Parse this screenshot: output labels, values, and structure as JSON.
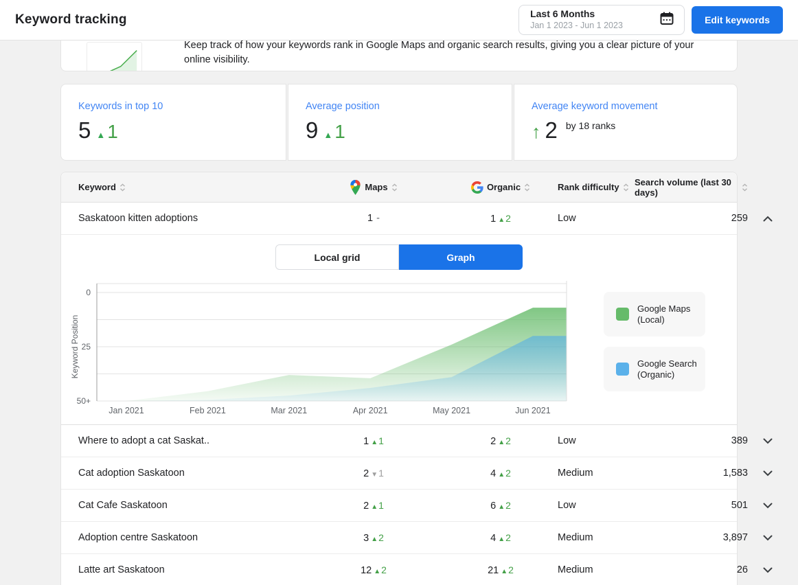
{
  "header": {
    "title": "Keyword tracking",
    "date_range": {
      "label": "Last 6 Months",
      "sublabel": "Jan 1 2023 - Jun 1 2023"
    },
    "edit_button": "Edit keywords"
  },
  "intro": {
    "line1_clipped": "Keep track of how your keywords rank in Google Maps and organic search results, giving you a clear picture of your",
    "line2": "online visibility."
  },
  "stats": [
    {
      "label": "Keywords in top 10",
      "value": "5",
      "change": "1"
    },
    {
      "label": "Average position",
      "value": "9",
      "change": "1"
    },
    {
      "label": "Average keyword movement",
      "value": "2",
      "suffix": "by 18 ranks"
    }
  ],
  "table": {
    "columns": {
      "keyword": "Keyword",
      "maps": "Maps",
      "organic": "Organic",
      "rank": "Rank difficulty",
      "volume": "Search volume (last 30 days)"
    },
    "toggle": {
      "local_grid": "Local grid",
      "graph": "Graph",
      "selected": "Graph"
    },
    "rows": [
      {
        "keyword": "Saskatoon kitten adoptions",
        "maps": "1",
        "maps_dir": "none",
        "maps_change": "-",
        "organic": "1",
        "organic_dir": "up",
        "organic_change": "2",
        "rank": "Low",
        "volume": "259",
        "expanded": true
      },
      {
        "keyword": "Where to adopt a cat Saskat..",
        "maps": "1",
        "maps_dir": "up",
        "maps_change": "1",
        "organic": "2",
        "organic_dir": "up",
        "organic_change": "2",
        "rank": "Low",
        "volume": "389",
        "expanded": false
      },
      {
        "keyword": "Cat adoption Saskatoon",
        "maps": "2",
        "maps_dir": "down",
        "maps_change": "1",
        "organic": "4",
        "organic_dir": "up",
        "organic_change": "2",
        "rank": "Medium",
        "volume": "1,583",
        "expanded": false
      },
      {
        "keyword": "Cat Cafe Saskatoon",
        "maps": "2",
        "maps_dir": "up",
        "maps_change": "1",
        "organic": "6",
        "organic_dir": "up",
        "organic_change": "2",
        "rank": "Low",
        "volume": "501",
        "expanded": false
      },
      {
        "keyword": "Adoption centre Saskatoon",
        "maps": "3",
        "maps_dir": "up",
        "maps_change": "2",
        "organic": "4",
        "organic_dir": "up",
        "organic_change": "2",
        "rank": "Medium",
        "volume": "3,897",
        "expanded": false
      },
      {
        "keyword": "Latte art Saskatoon",
        "maps": "12",
        "maps_dir": "up",
        "maps_change": "2",
        "organic": "21",
        "organic_dir": "up",
        "organic_change": "2",
        "rank": "Medium",
        "volume": "26",
        "expanded": false
      }
    ]
  },
  "chart_data": {
    "type": "area",
    "title": "Keyword position history for Saskatoon kitten adoptions",
    "x": [
      "Jan 2021",
      "Feb 2021",
      "Mar 2021",
      "Apr 2021",
      "May 2021",
      "Jun 2021"
    ],
    "xlabel": "",
    "ylabel": "Keyword Position",
    "y_ticks": [
      "0",
      "25",
      "50+"
    ],
    "y_tick_values": [
      0,
      25,
      50
    ],
    "ylim": [
      0,
      50
    ],
    "y_inverted": true,
    "grid": true,
    "legend_position": "right",
    "series": [
      {
        "name": "Google Maps (Local)",
        "color": "#66bb6a",
        "values": [
          50,
          45.5,
          38,
          39.5,
          24,
          7
        ]
      },
      {
        "name": "Google Search (Organic)",
        "color": "#4faaea",
        "values": [
          50,
          49.5,
          47.5,
          44,
          39,
          20
        ]
      }
    ],
    "legend": [
      {
        "line1": "Google Maps",
        "line2": "(Local)",
        "color": "#66bb6a"
      },
      {
        "line1": "Google Search",
        "line2": "(Organic)",
        "color": "#5bb1ea"
      }
    ]
  },
  "colors": {
    "accent_blue": "#1a73e8",
    "stat_label_blue": "#4285f4",
    "positive_green": "#43a047",
    "neutral_gray": "#9e9e9e",
    "header_bg": "#f5f5f5"
  }
}
